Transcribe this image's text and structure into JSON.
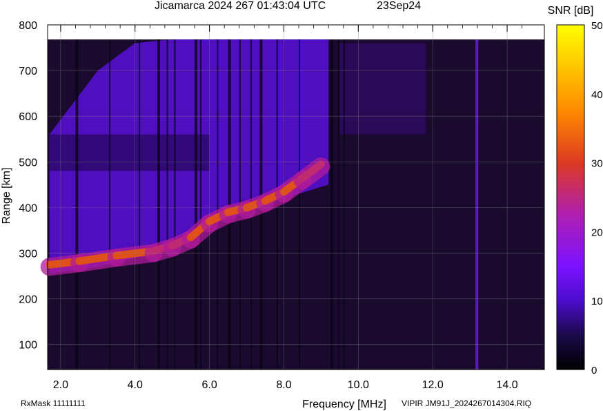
{
  "title": "Jicamarca 2024 267 01:43:04 UTC",
  "date": "23Sep24",
  "footer_left": "RxMask 11111111",
  "footer_right": "VIPIR  JM91J_2024267014304.RIQ",
  "chart_data": {
    "type": "heatmap",
    "title": "Jicamarca 2024 267 01:43:04 UTC",
    "xlabel": "Frequency [MHz]",
    "ylabel": "Range [km]",
    "xlim": [
      1.65,
      15.0
    ],
    "ylim": [
      45,
      800
    ],
    "xticks": [
      "2.0",
      "4.0",
      "6.0",
      "8.0",
      "10.0",
      "12.0",
      "14.0"
    ],
    "yticks": [
      "100",
      "200",
      "300",
      "400",
      "500",
      "600",
      "700",
      "800"
    ],
    "grid": true,
    "colorbar": {
      "label": "SNR [dB]",
      "range": [
        0,
        50
      ],
      "ticks": [
        "0",
        "10",
        "20",
        "30",
        "40",
        "50"
      ],
      "colors": [
        "#000000",
        "#1a0a4a",
        "#4b0ccc",
        "#7b12ff",
        "#b01fb0",
        "#dd3a22",
        "#ff8a00",
        "#ffd000",
        "#ffff00"
      ]
    },
    "ionogram_trace": {
      "x": [
        1.7,
        2.5,
        3.5,
        4.5,
        5.0,
        5.5,
        6.0,
        6.5,
        7.0,
        7.5,
        8.0,
        8.5,
        9.0
      ],
      "y": [
        270,
        278,
        290,
        300,
        312,
        330,
        365,
        385,
        395,
        410,
        430,
        460,
        490
      ]
    }
  }
}
